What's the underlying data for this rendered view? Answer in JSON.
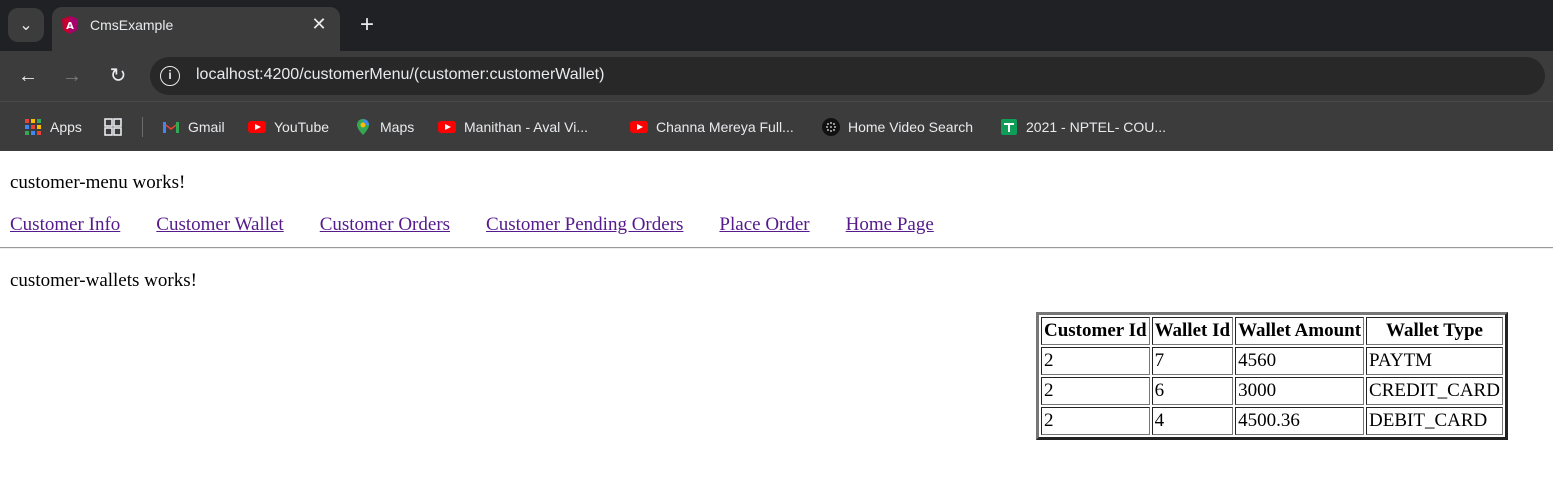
{
  "browser": {
    "tab_title": "CmsExample",
    "url": "localhost:4200/customerMenu/(customer:customerWallet)",
    "bookmarks": [
      {
        "label": "Apps",
        "icon": "apps-grid-icon"
      },
      {
        "label": "",
        "icon": "tab-groups-icon"
      },
      {
        "label": "Gmail",
        "icon": "gmail-icon"
      },
      {
        "label": "YouTube",
        "icon": "youtube-icon"
      },
      {
        "label": "Maps",
        "icon": "maps-icon"
      },
      {
        "label": "Manithan - Aval Vi...",
        "icon": "youtube-icon"
      },
      {
        "label": "Channa Mereya Full...",
        "icon": "youtube-icon"
      },
      {
        "label": "Home Video Search",
        "icon": "dots-icon"
      },
      {
        "label": "2021 - NPTEL- COU...",
        "icon": "sheets-icon"
      }
    ]
  },
  "page": {
    "menu_heading": "customer-menu works!",
    "nav_links": [
      "Customer Info",
      "Customer Wallet",
      "Customer Orders",
      "Customer Pending Orders",
      "Place Order",
      "Home Page"
    ],
    "wallets_heading": "customer-wallets works!",
    "table": {
      "headers": [
        "Customer Id",
        "Wallet Id",
        "Wallet Amount",
        "Wallet Type"
      ],
      "rows": [
        [
          "2",
          "7",
          "4560",
          "PAYTM"
        ],
        [
          "2",
          "6",
          "3000",
          "CREDIT_CARD"
        ],
        [
          "2",
          "4",
          "4500.36",
          "DEBIT_CARD"
        ]
      ]
    }
  }
}
